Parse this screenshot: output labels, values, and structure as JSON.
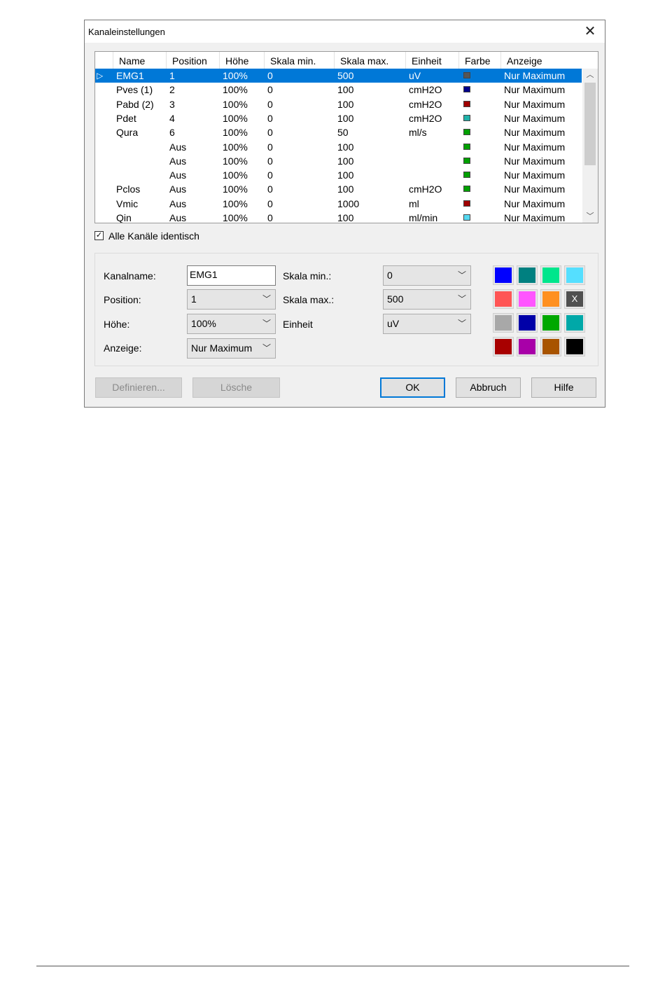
{
  "dialog": {
    "title": "Kanaleinstellungen",
    "close_glyph": "✕"
  },
  "grid": {
    "headers": [
      "Name",
      "Position",
      "Höhe",
      "Skala min.",
      "Skala max.",
      "Einheit",
      "Farbe",
      "Anzeige"
    ],
    "selected_indicator": "▷",
    "rows": [
      {
        "name": "EMG1",
        "position": "1",
        "hoehe": "100%",
        "min": "0",
        "max": "500",
        "einheit": "uV",
        "farbe": "#555555",
        "anzeige": "Nur Maximum",
        "selected": true
      },
      {
        "name": "Pves (1)",
        "position": "2",
        "hoehe": "100%",
        "min": "0",
        "max": "100",
        "einheit": "cmH2O",
        "farbe": "#00008b",
        "anzeige": "Nur Maximum"
      },
      {
        "name": "Pabd (2)",
        "position": "3",
        "hoehe": "100%",
        "min": "0",
        "max": "100",
        "einheit": "cmH2O",
        "farbe": "#a00000",
        "anzeige": "Nur Maximum"
      },
      {
        "name": "Pdet",
        "position": "4",
        "hoehe": "100%",
        "min": "0",
        "max": "100",
        "einheit": "cmH2O",
        "farbe": "#20b2aa",
        "anzeige": "Nur Maximum"
      },
      {
        "name": "Qura",
        "position": "6",
        "hoehe": "100%",
        "min": "0",
        "max": "50",
        "einheit": "ml/s",
        "farbe": "#00a000",
        "anzeige": "Nur Maximum"
      },
      {
        "name": "",
        "position": "Aus",
        "hoehe": "100%",
        "min": "0",
        "max": "100",
        "einheit": "",
        "farbe": "#00a000",
        "anzeige": "Nur Maximum"
      },
      {
        "name": "",
        "position": "Aus",
        "hoehe": "100%",
        "min": "0",
        "max": "100",
        "einheit": "",
        "farbe": "#00a000",
        "anzeige": "Nur Maximum"
      },
      {
        "name": "",
        "position": "Aus",
        "hoehe": "100%",
        "min": "0",
        "max": "100",
        "einheit": "",
        "farbe": "#00a000",
        "anzeige": "Nur Maximum"
      },
      {
        "name": "Pclos",
        "position": "Aus",
        "hoehe": "100%",
        "min": "0",
        "max": "100",
        "einheit": "cmH2O",
        "farbe": "#00a000",
        "anzeige": "Nur Maximum"
      },
      {
        "name": "Vmic",
        "position": "Aus",
        "hoehe": "100%",
        "min": "0",
        "max": "1000",
        "einheit": "ml",
        "farbe": "#a00000",
        "anzeige": "Nur Maximum"
      },
      {
        "name": "Qin",
        "position": "Aus",
        "hoehe": "100%",
        "min": "0",
        "max": "100",
        "einheit": "ml/min",
        "farbe": "#55d8f0",
        "anzeige": "Nur Maximum"
      }
    ]
  },
  "checkbox": {
    "label": "Alle Kanäle identisch",
    "checked": true,
    "check_glyph": "✓"
  },
  "form": {
    "kanalname_label": "Kanalname:",
    "kanalname_value": "EMG1",
    "position_label": "Position:",
    "position_value": "1",
    "hoehe_label": "Höhe:",
    "hoehe_value": "100%",
    "anzeige_label": "Anzeige:",
    "anzeige_value": "Nur Maximum",
    "skala_min_label": "Skala min.:",
    "skala_min_value": "0",
    "skala_max_label": "Skala max.:",
    "skala_max_value": "500",
    "einheit_label": "Einheit",
    "einheit_value": "uV",
    "chevron": "﹀"
  },
  "palette": {
    "colors": [
      "#0000ff",
      "#008080",
      "#00e68c",
      "#55dfff",
      "#ff5555",
      "#ff55ff",
      "#ff9020",
      "#505050",
      "#a8a8a8",
      "#0000a8",
      "#00a800",
      "#00a8a8",
      "#a80000",
      "#a800a8",
      "#a85400",
      "#000000"
    ],
    "x_label": "X"
  },
  "buttons": {
    "definieren": "Definieren...",
    "loesche": "Lösche",
    "ok": "OK",
    "abbruch": "Abbruch",
    "hilfe": "Hilfe"
  }
}
